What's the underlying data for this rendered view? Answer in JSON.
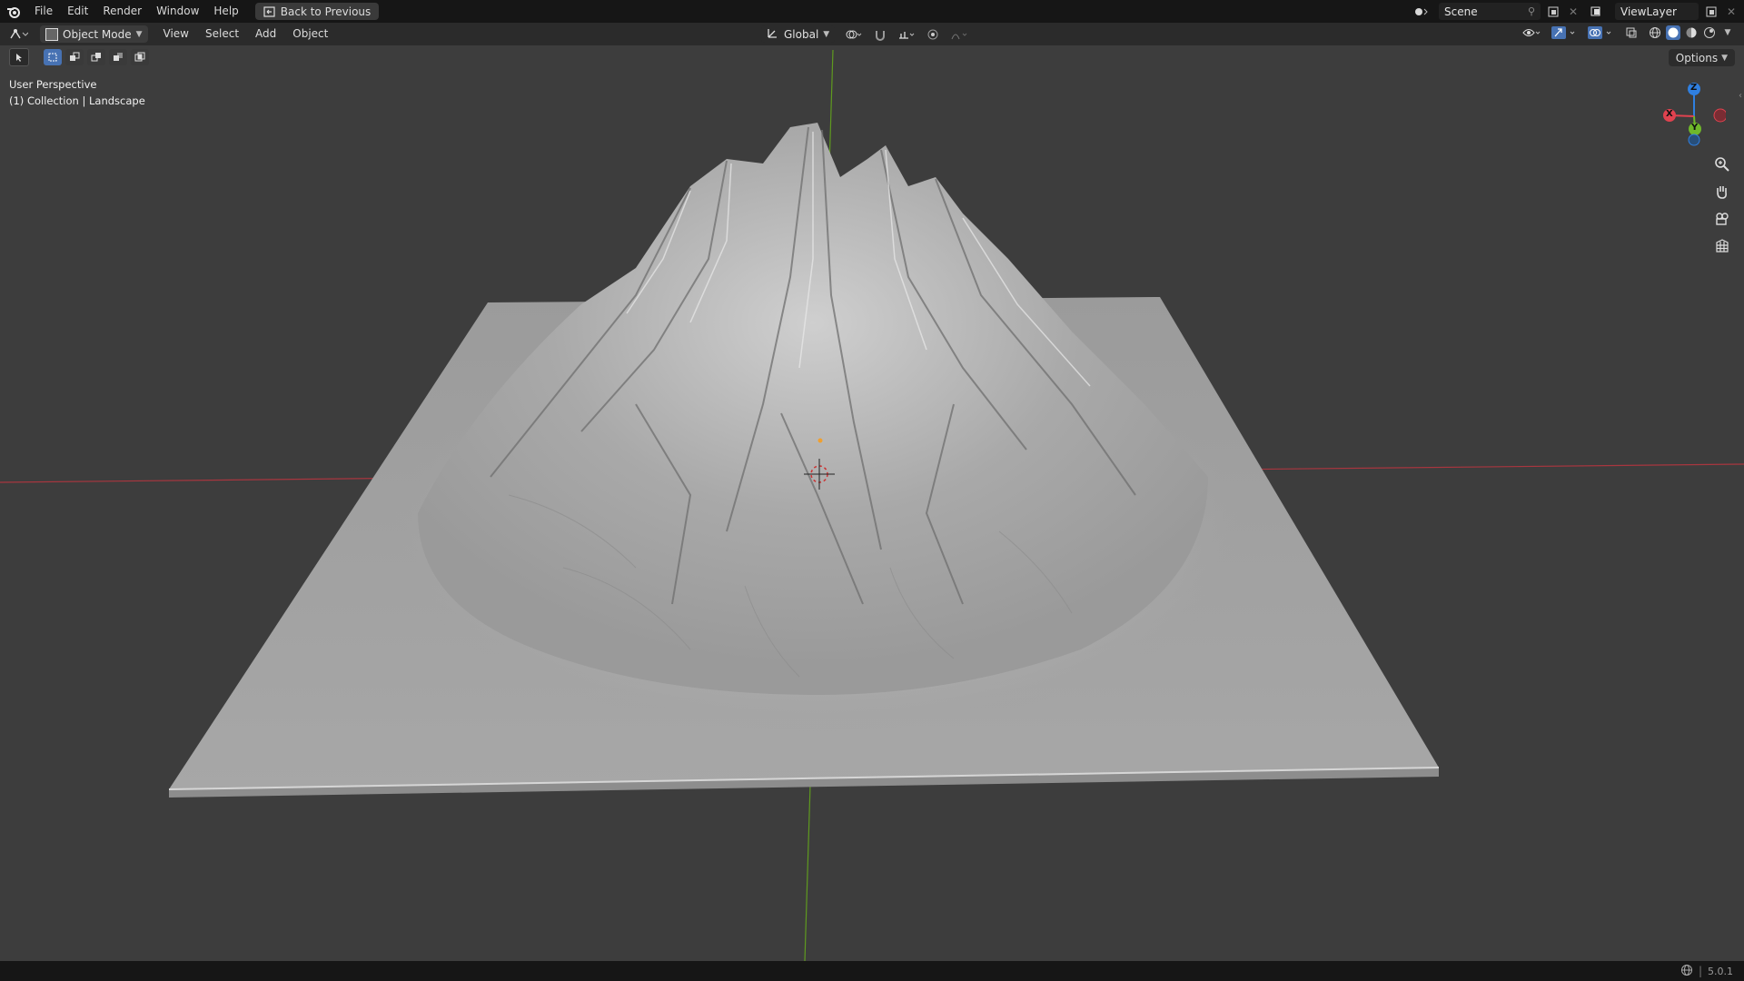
{
  "topbar": {
    "menus": [
      "File",
      "Edit",
      "Render",
      "Window",
      "Help"
    ],
    "back_button": "Back to Previous",
    "scene_label": "Scene",
    "view_layer_label": "ViewLayer"
  },
  "header": {
    "mode": "Object Mode",
    "menus": [
      "View",
      "Select",
      "Add",
      "Object"
    ],
    "transform_orientation": "Global",
    "options_label": "Options"
  },
  "viewport": {
    "perspective_label": "User Perspective",
    "collection_label": "(1) Collection | Landscape",
    "gizmo": {
      "x": "X",
      "y": "Y",
      "z": "Z"
    },
    "colors": {
      "x_axis": "#e0424f",
      "y_axis": "#6fb82a",
      "z_axis": "#2f7fe0",
      "background": "#3d3d3d"
    }
  },
  "status": {
    "version": "5.0.1"
  },
  "icons": {
    "blender_logo": "blender-logo-icon",
    "zoom": "zoom-icon",
    "pan": "hand-icon",
    "camera": "camera-icon",
    "ortho": "grid-icon"
  }
}
